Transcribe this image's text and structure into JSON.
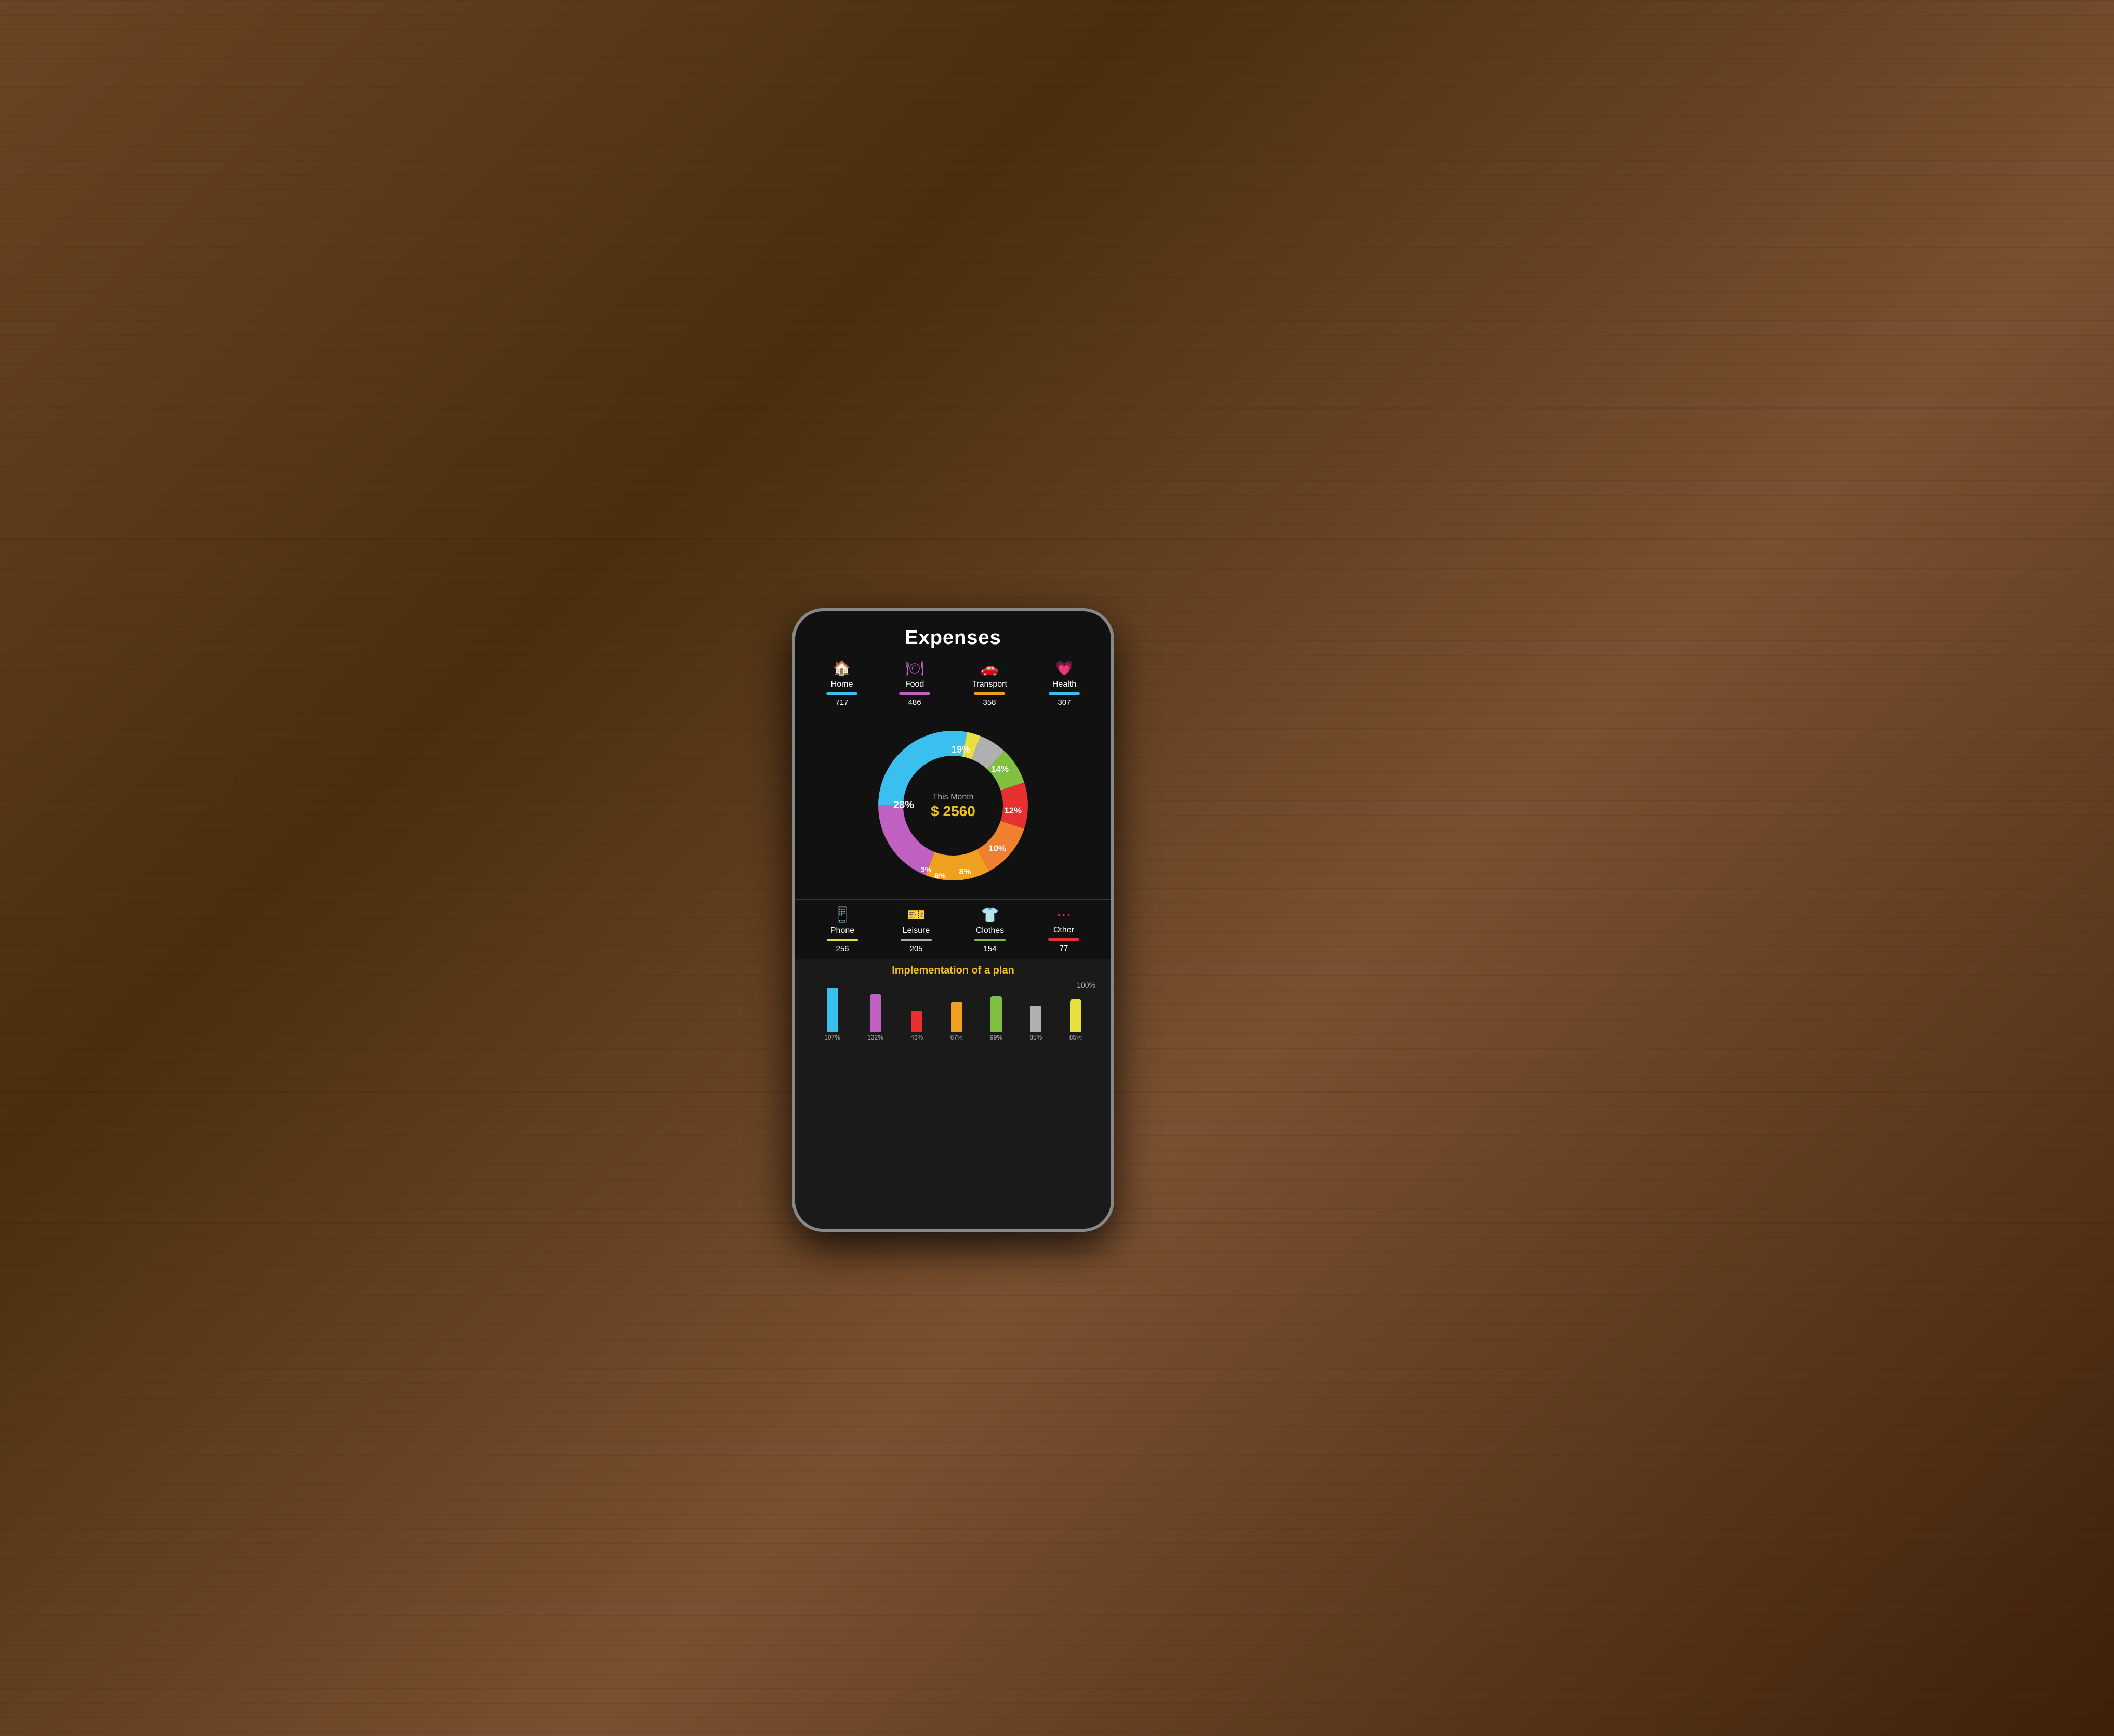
{
  "app": {
    "title": "Expenses",
    "chart": {
      "center_label": "This Month",
      "center_value": "$ 2560",
      "segments": [
        {
          "label": "Home",
          "percent": 28,
          "color": "#3bbfef",
          "start": 0,
          "end": 100.8
        },
        {
          "label": "Leisure",
          "percent": 3,
          "color": "#e8e040",
          "start": 100.8,
          "end": 111.6
        },
        {
          "label": "Phone",
          "percent": 6,
          "color": "#c0c0c0",
          "start": 111.6,
          "end": 133.2
        },
        {
          "label": "Clothes",
          "percent": 8,
          "color": "#80c040",
          "start": 133.2,
          "end": 162
        },
        {
          "label": "Other",
          "percent": 10,
          "color": "#e83030",
          "start": 162,
          "end": 198
        },
        {
          "label": "Health",
          "percent": 12,
          "color": "#f08030",
          "start": 198,
          "end": 241.2
        },
        {
          "label": "Transport",
          "percent": 14,
          "color": "#f0a020",
          "start": 241.2,
          "end": 291.6
        },
        {
          "label": "Food",
          "percent": 19,
          "color": "#c060c0",
          "start": 291.6,
          "end": 360
        }
      ]
    },
    "top_categories": [
      {
        "label": "Home",
        "value": "717",
        "icon": "🏠",
        "bar_color": "#3bbfef"
      },
      {
        "label": "Food",
        "value": "486",
        "icon": "🍽",
        "bar_color": "#c060c0"
      },
      {
        "label": "Transport",
        "value": "358",
        "icon": "🚗",
        "bar_color": "#f0a020"
      },
      {
        "label": "Health",
        "value": "307",
        "icon": "💗",
        "bar_color": "#3bbfef"
      }
    ],
    "bottom_categories": [
      {
        "label": "Phone",
        "value": "256",
        "icon": "📱",
        "bar_color": "#e8e040"
      },
      {
        "label": "Leisure",
        "value": "205",
        "icon": "🎫",
        "bar_color": "#c0c0c0"
      },
      {
        "label": "Clothes",
        "value": "154",
        "icon": "👕",
        "bar_color": "#80c040"
      },
      {
        "label": "Other",
        "value": "77",
        "icon": "···",
        "bar_color": "#e83030"
      }
    ],
    "implementation": {
      "title": "Implementation of a plan",
      "max_label": "100%",
      "bars": [
        {
          "color": "#3bbfef",
          "height": 85,
          "pct": "107%"
        },
        {
          "color": "#c060c0",
          "height": 72,
          "pct": "132%"
        },
        {
          "color": "#e83030",
          "height": 40,
          "pct": "43%"
        },
        {
          "color": "#f0a020",
          "height": 58,
          "pct": "67%"
        },
        {
          "color": "#80c040",
          "height": 68,
          "pct": "99%"
        },
        {
          "color": "#c0c0c0",
          "height": 50,
          "pct": "85%"
        },
        {
          "color": "#e8e040",
          "height": 62,
          "pct": "85%"
        }
      ]
    }
  }
}
